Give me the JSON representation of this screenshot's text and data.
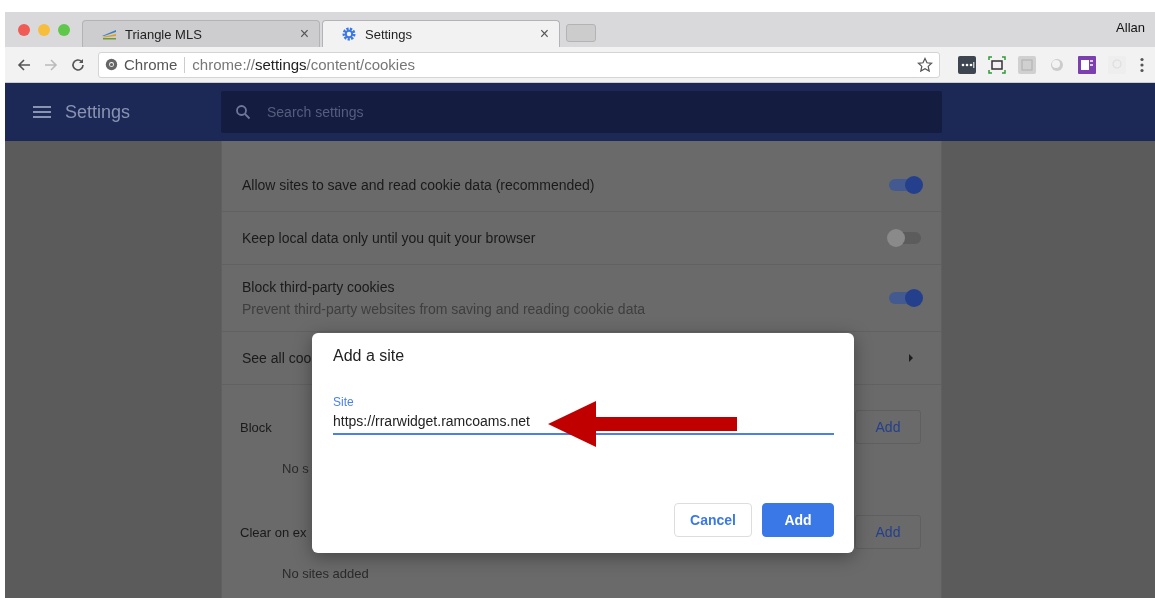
{
  "browser": {
    "tabs": [
      {
        "title": "Triangle MLS",
        "close": "×",
        "selected": false
      },
      {
        "title": "Settings",
        "close": "×",
        "selected": true
      }
    ],
    "profile": "Allan",
    "address": {
      "chip": "Chrome",
      "url": "chrome://**settings**/content/cookies"
    }
  },
  "header": {
    "title": "Settings",
    "search_placeholder": "Search settings"
  },
  "settings": {
    "toggles": [
      {
        "label": "Allow sites to save and read cookie data (recommended)",
        "on": true
      },
      {
        "label": "Keep local data only until you quit your browser",
        "on": false
      },
      {
        "label": "Block third-party cookies",
        "description": "Prevent third-party websites from saving and reading cookie data",
        "on": true
      }
    ],
    "link_row": "See all coo",
    "sections": [
      {
        "title": "Block",
        "button": "Add",
        "empty": "No s"
      },
      {
        "title": "Clear on ex",
        "button": "Add",
        "empty": "No sites added"
      }
    ]
  },
  "dialog": {
    "title": "Add a site",
    "field": {
      "label": "Site",
      "value": "https://rrarwidget.ramcoams.net"
    },
    "buttons": [
      {
        "label": "Cancel",
        "kind": "secondary"
      },
      {
        "label": "Add",
        "kind": "primary"
      }
    ]
  }
}
